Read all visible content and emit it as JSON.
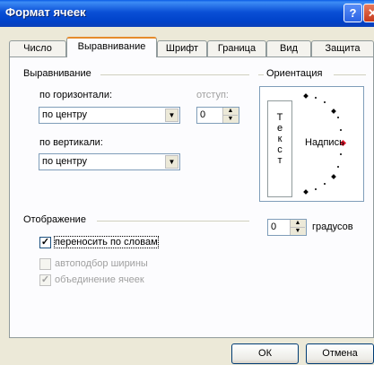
{
  "window": {
    "title": "Формат ячеек",
    "help_label": "?",
    "close_label": "✕"
  },
  "tabs": [
    {
      "label": "Число"
    },
    {
      "label": "Выравнивание"
    },
    {
      "label": "Шрифт"
    },
    {
      "label": "Граница"
    },
    {
      "label": "Вид"
    },
    {
      "label": "Защита"
    }
  ],
  "alignment": {
    "group_label": "Выравнивание",
    "horizontal_label": "по горизонтали:",
    "horizontal_value": "по центру",
    "indent_label": "отступ:",
    "indent_value": "0",
    "vertical_label": "по вертикали:",
    "vertical_value": "по центру"
  },
  "display": {
    "group_label": "Отображение",
    "wrap_text": {
      "label": "переносить по словам",
      "checked": true,
      "mark": "✓"
    },
    "shrink_to_fit": {
      "label": "автоподбор ширины",
      "checked": false,
      "mark": ""
    },
    "merge_cells": {
      "label": "объединение ячеек",
      "checked": true,
      "mark": "✓"
    }
  },
  "orientation": {
    "group_label": "Ориентация",
    "vertical_text": "Т е к с т",
    "vertical_letters": [
      "Т",
      "е",
      "к",
      "с",
      "т"
    ],
    "sample_text": "Надпись",
    "degrees_value": "0",
    "degrees_label": "градусов"
  },
  "buttons": {
    "ok": "ОК",
    "cancel": "Отмена"
  },
  "colors": {
    "accent": "#e68b2c",
    "title_bar": "#0a4fd6",
    "indicator": "#e0162c"
  },
  "icons": {
    "dropdown": "chevron-down-icon",
    "spin_up": "triangle-up-icon",
    "spin_down": "triangle-down-icon"
  }
}
